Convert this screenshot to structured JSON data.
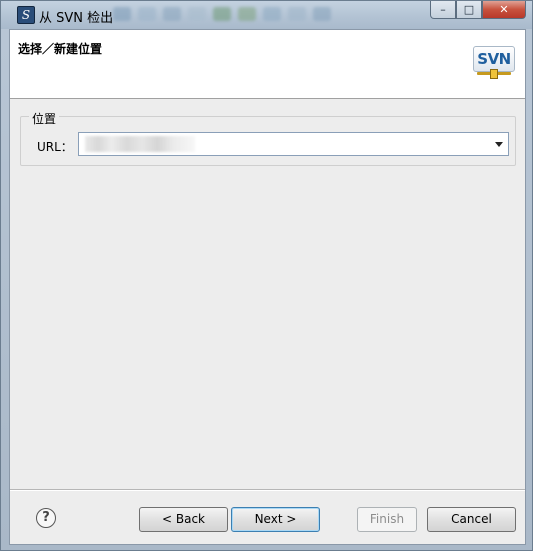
{
  "window": {
    "title": "从 SVN 检出",
    "app_icon": "svn-app-icon",
    "controls": {
      "minimize": "–",
      "maximize": "□",
      "close": "✕"
    }
  },
  "header": {
    "title": "选择／新建位置",
    "logo_text": "SVN"
  },
  "location_group": {
    "label": "位置",
    "url_label": "URL：",
    "url_value": ""
  },
  "footer": {
    "help_symbol": "?",
    "back_label": "< Back",
    "next_label": "Next >",
    "finish_label": "Finish",
    "cancel_label": "Cancel"
  },
  "colors": {
    "dialog_background": "#ededed",
    "header_background": "#ffffff",
    "close_button": "#c8523e",
    "default_button_border": "#3c7fb1"
  }
}
